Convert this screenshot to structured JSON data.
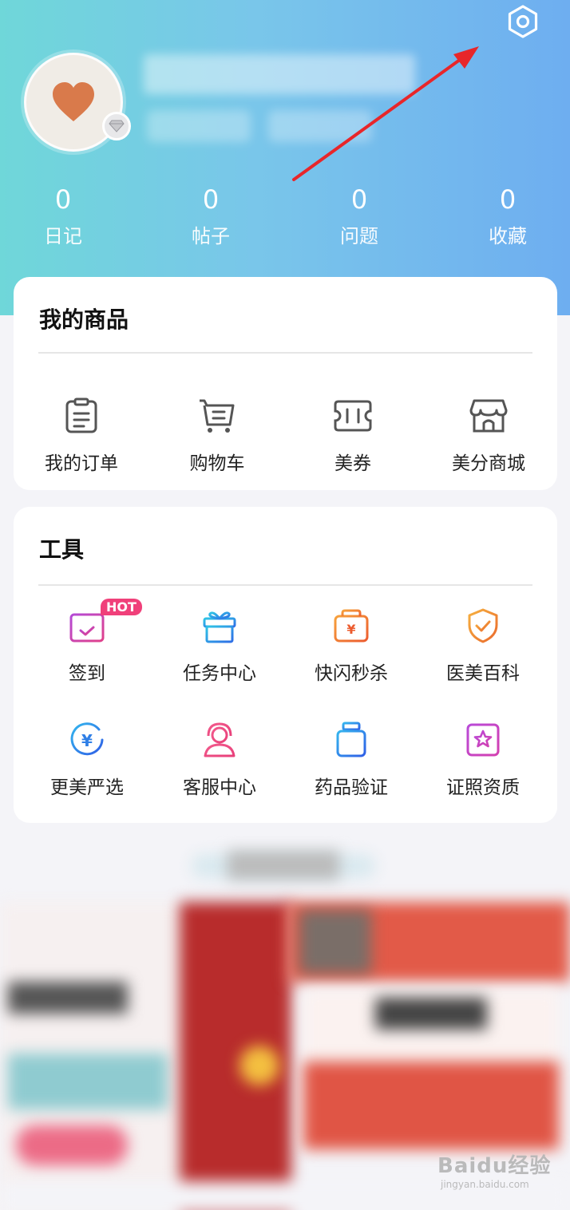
{
  "stats": [
    {
      "value": "0",
      "label": "日记"
    },
    {
      "value": "0",
      "label": "帖子"
    },
    {
      "value": "0",
      "label": "问题"
    },
    {
      "value": "0",
      "label": "收藏"
    }
  ],
  "goods": {
    "title": "我的商品",
    "items": [
      {
        "label": "我的订单",
        "icon": "clipboard-icon"
      },
      {
        "label": "购物车",
        "icon": "cart-icon"
      },
      {
        "label": "美券",
        "icon": "coupon-icon"
      },
      {
        "label": "美分商城",
        "icon": "store-icon"
      }
    ]
  },
  "tools": {
    "title": "工具",
    "hot_badge": "HOT",
    "items": [
      {
        "label": "签到",
        "icon": "calendar-check-icon"
      },
      {
        "label": "任务中心",
        "icon": "gift-box-icon"
      },
      {
        "label": "快闪秒杀",
        "icon": "flash-sale-bag-icon"
      },
      {
        "label": "医美百科",
        "icon": "shield-check-icon"
      },
      {
        "label": "更美严选",
        "icon": "yen-circle-icon"
      },
      {
        "label": "客服中心",
        "icon": "headset-agent-icon"
      },
      {
        "label": "药品验证",
        "icon": "medicine-bottle-icon"
      },
      {
        "label": "证照资质",
        "icon": "certificate-star-icon"
      }
    ]
  },
  "watermark": {
    "line1": "Baidu经验",
    "line2": "jingyan.baidu.com"
  },
  "colors": {
    "hero_start": "#6fd7d9",
    "hero_end": "#6eaef0",
    "annotation_arrow": "#e8262a",
    "hot_badge": "#f0407a"
  }
}
